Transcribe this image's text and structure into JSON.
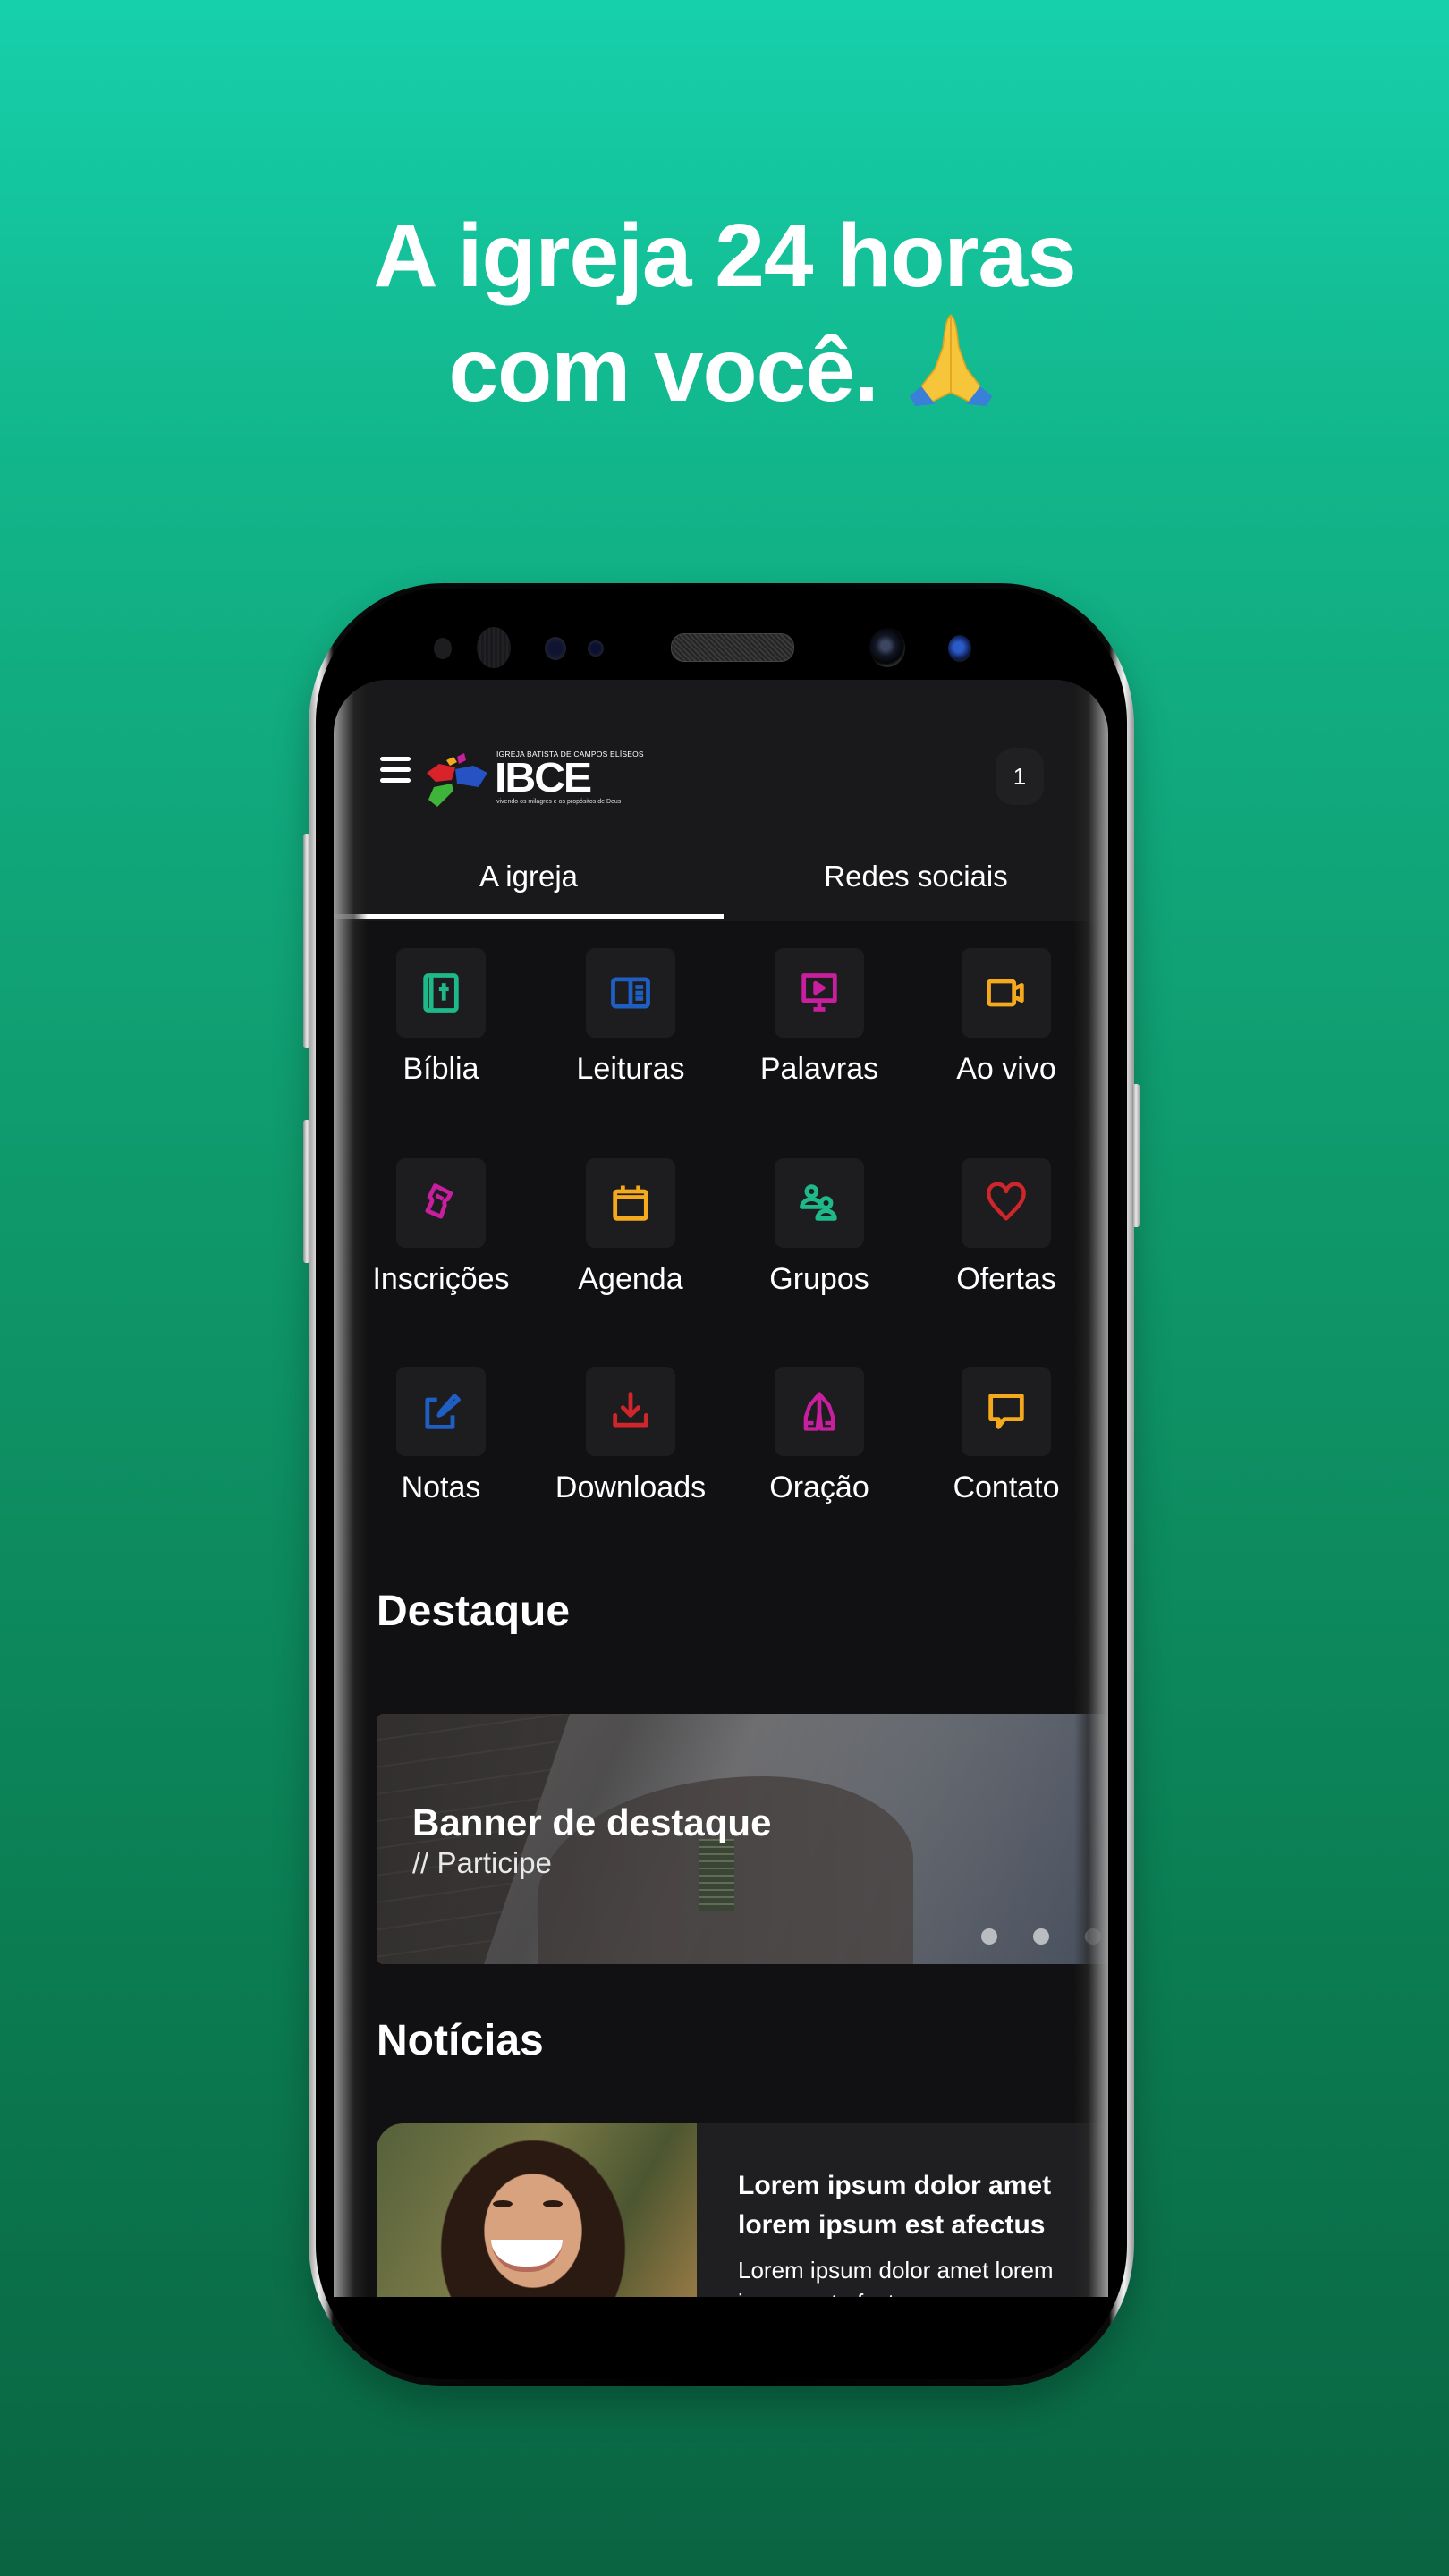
{
  "headline": {
    "line1": "A igreja 24 horas",
    "line2": "com você.",
    "emoji": "folded-hands-emoji"
  },
  "app": {
    "logo": {
      "top_text": "IGREJA BATISTA DE CAMPOS ELÍSEOS",
      "main_text": "IBCE",
      "tagline": "vivendo os milagres e os propósitos de Deus"
    },
    "notification_badge": "1",
    "tabs": [
      {
        "label": "A igreja",
        "active": true
      },
      {
        "label": "Redes sociais",
        "active": false
      }
    ],
    "menu": [
      {
        "label": "Bíblia",
        "icon": "bible-icon",
        "color": "#1fb889"
      },
      {
        "label": "Leituras",
        "icon": "book-open-icon",
        "color": "#1f5fc4"
      },
      {
        "label": "Palavras",
        "icon": "video-screen-icon",
        "color": "#c81f9e"
      },
      {
        "label": "Ao vivo",
        "icon": "video-camera-icon",
        "color": "#f5a91c"
      },
      {
        "label": "Inscrições",
        "icon": "ticket-icon",
        "color": "#c81f9e"
      },
      {
        "label": "Agenda",
        "icon": "calendar-icon",
        "color": "#f5a91c"
      },
      {
        "label": "Grupos",
        "icon": "group-icon",
        "color": "#1fb889"
      },
      {
        "label": "Ofertas",
        "icon": "heart-icon",
        "color": "#d0262b"
      },
      {
        "label": "Notas",
        "icon": "edit-note-icon",
        "color": "#1f5fc4"
      },
      {
        "label": "Downloads",
        "icon": "download-icon",
        "color": "#d0262b"
      },
      {
        "label": "Oração",
        "icon": "praying-hands-icon",
        "color": "#c81f9e"
      },
      {
        "label": "Contato",
        "icon": "chat-bubble-icon",
        "color": "#f5a91c"
      }
    ],
    "destaque": {
      "title": "Destaque",
      "banner_title": "Banner de destaque",
      "banner_subtitle": "// Participe",
      "slide_count": 3
    },
    "noticias": {
      "title": "Notícias",
      "items": [
        {
          "title": "Lorem ipsum dolor amet lorem ipsum est afectus",
          "body": "Lorem ipsum dolor amet lorem ipsum est afectus"
        }
      ]
    }
  }
}
